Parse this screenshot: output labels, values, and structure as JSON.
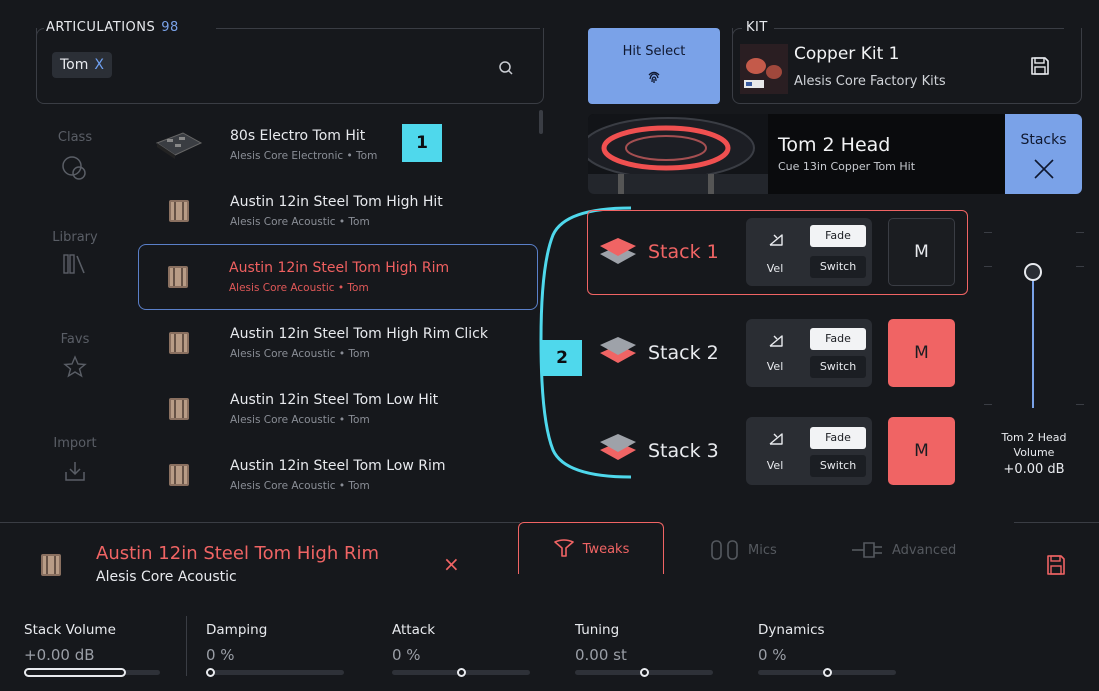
{
  "articulations": {
    "title": "ARTICULATIONS",
    "count": "98",
    "filter_chip": "Tom",
    "filter_chip_close": "X",
    "search_icon": "search-icon"
  },
  "sidebar": {
    "items": [
      {
        "label": "Class",
        "icon": "class-icon"
      },
      {
        "label": "Library",
        "icon": "library-icon"
      },
      {
        "label": "Favs",
        "icon": "star-icon"
      },
      {
        "label": "Import",
        "icon": "import-icon"
      }
    ]
  },
  "list": {
    "items": [
      {
        "title": "80s Electro Tom Hit",
        "subtitle": "Alesis Core Electronic • Tom"
      },
      {
        "title": "Austin 12in Steel Tom High Hit",
        "subtitle": "Alesis Core Acoustic • Tom"
      },
      {
        "title": "Austin 12in Steel Tom High Rim",
        "subtitle": "Alesis Core Acoustic • Tom",
        "selected": true
      },
      {
        "title": "Austin 12in Steel Tom High Rim Click",
        "subtitle": "Alesis Core Acoustic • Tom"
      },
      {
        "title": "Austin 12in Steel Tom Low Hit",
        "subtitle": "Alesis Core Acoustic • Tom"
      },
      {
        "title": "Austin 12in Steel Tom Low Rim",
        "subtitle": "Alesis Core Acoustic • Tom"
      }
    ]
  },
  "callouts": {
    "one": "1",
    "two": "2"
  },
  "hit_select": {
    "label": "Hit Select"
  },
  "kit": {
    "section_label": "KIT",
    "name": "Copper Kit 1",
    "library": "Alesis Core Factory Kits"
  },
  "pad": {
    "title": "Tom 2 Head",
    "subtitle": "Cue 13in Copper Tom Hit",
    "stacks_label": "Stacks"
  },
  "stacks": [
    {
      "name": "Stack 1",
      "vel": "Vel",
      "fade": "Fade",
      "switch": "Switch",
      "mute": "M",
      "muted": false,
      "active": true
    },
    {
      "name": "Stack 2",
      "vel": "Vel",
      "fade": "Fade",
      "switch": "Switch",
      "mute": "M",
      "muted": true,
      "active": false
    },
    {
      "name": "Stack 3",
      "vel": "Vel",
      "fade": "Fade",
      "switch": "Switch",
      "mute": "M",
      "muted": true,
      "active": false
    }
  ],
  "volume": {
    "label_line1": "Tom 2 Head",
    "label_line2": "Volume",
    "value": "+0.00 dB"
  },
  "selected": {
    "title": "Austin 12in Steel Tom High Rim",
    "subtitle": "Alesis Core Acoustic",
    "close": "×"
  },
  "tabs": [
    {
      "label": "Tweaks",
      "icon": "tweaks-icon",
      "active": true
    },
    {
      "label": "Mics",
      "icon": "mics-icon",
      "active": false
    },
    {
      "label": "Advanced",
      "icon": "advanced-icon",
      "active": false
    }
  ],
  "params": [
    {
      "label": "Stack Volume",
      "value": "+0.00 dB",
      "level": 0.75
    },
    {
      "label": "Damping",
      "value": "0 %",
      "level": 0.0
    },
    {
      "label": "Attack",
      "value": "0 %",
      "level": 0.5
    },
    {
      "label": "Tuning",
      "value": "0.00 st",
      "level": 0.5
    },
    {
      "label": "Dynamics",
      "value": "0 %",
      "level": 0.5
    }
  ],
  "colors": {
    "accent_blue": "#7aa2e8",
    "accent_red": "#f06464",
    "callout_cyan": "#4fd8ec",
    "background": "#16181c"
  }
}
